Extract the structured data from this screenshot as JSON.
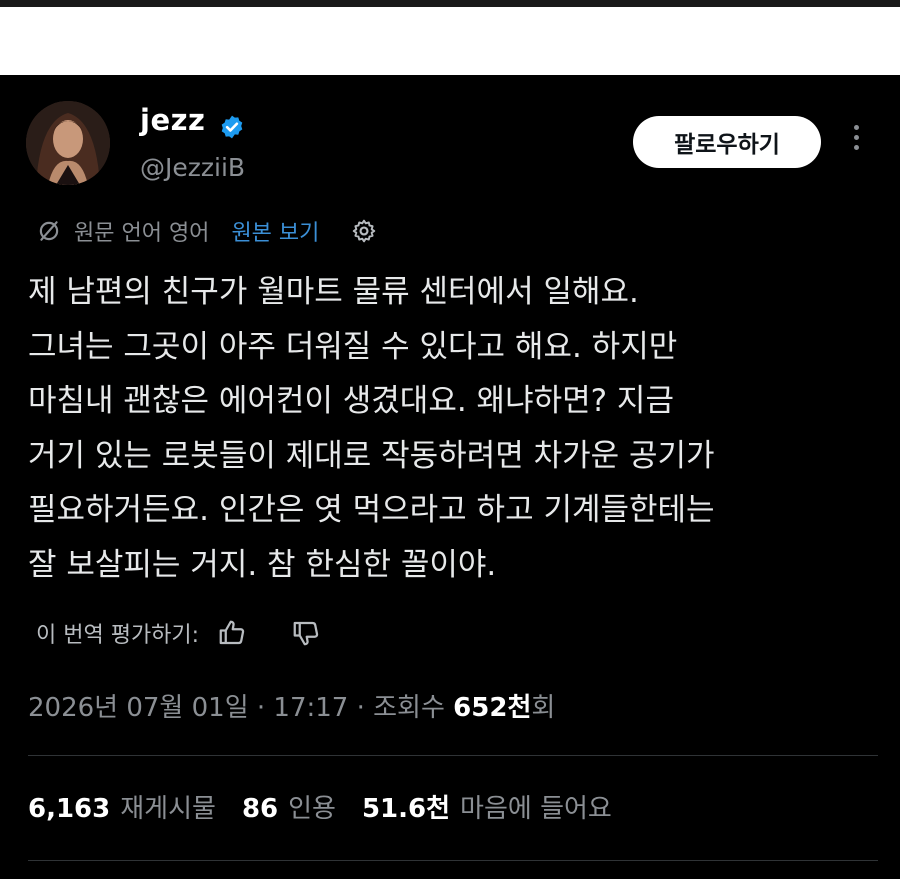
{
  "user": {
    "display_name": "jezz",
    "handle": "@JezziiB",
    "verified": true
  },
  "follow_button_label": "팔로우하기",
  "translation": {
    "label": "원문 언어 영어",
    "show_original": "원본 보기"
  },
  "tweet_text": "제 남편의 친구가 월마트 물류 센터에서 일해요.\n그녀는 그곳이 아주 더워질 수 있다고 해요. 하지만\n마침내 괜찮은 에어컨이 생겼대요. 왜냐하면? 지금\n거기 있는 로봇들이 제대로 작동하려면 차가운 공기가\n필요하거든요. 인간은 엿 먹으라고 하고 기계들한테는\n잘 보살피는 거지. 참 한심한 꼴이야.",
  "rate_translation": {
    "label": "이 번역 평가하기:"
  },
  "meta": {
    "timestamp": "2026년 07월 01일 · 17:17 · 조회수",
    "views_number": "652천",
    "views_suffix": "회"
  },
  "stats": {
    "reposts_count": "6,163",
    "reposts_label": "재게시물",
    "quotes_count": "86",
    "quotes_label": "인용",
    "likes_count": "51.6천",
    "likes_label": "마음에 들어요"
  },
  "colors": {
    "background": "#000000",
    "text": "#e7e9ea",
    "secondary_text": "#8b8f94",
    "link": "#3b8fd6",
    "verified": "#1d9bf0"
  },
  "icons": [
    "verified-badge-icon",
    "more-icon",
    "translate-icon",
    "gear-icon",
    "thumbs-up-icon",
    "thumbs-down-icon"
  ]
}
